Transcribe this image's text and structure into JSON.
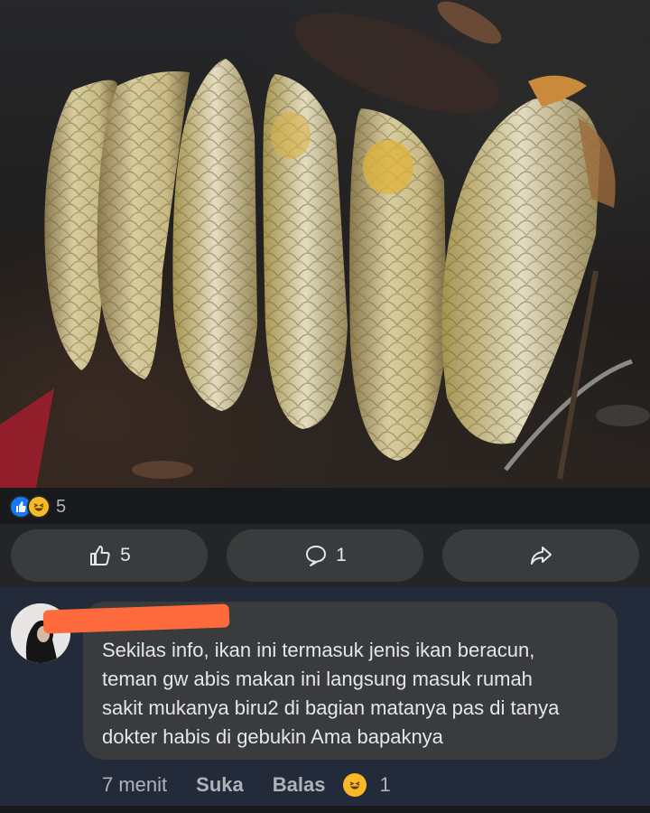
{
  "post": {
    "photo_icon": "photo-of-six-arowana-fish",
    "reactions": {
      "icons": [
        "like-icon",
        "haha-icon"
      ],
      "count": "5"
    }
  },
  "actions": {
    "like_count": "5",
    "comment_count": "1",
    "share_icon": "share-icon"
  },
  "comment": {
    "avatar_icon": "avatar",
    "author_redacted": true,
    "lines": [
      "Sekilas info, ikan ini termasuk jenis ikan beracun,",
      "teman gw abis makan ini langsung masuk rumah",
      "sakit mukanya biru2 di bagian matanya pas di tanya",
      "dokter habis di gebukin Ama bapaknya"
    ],
    "time": "7 menit",
    "like_label": "Suka",
    "reply_label": "Balas",
    "reaction_count": "1"
  },
  "colors": {
    "background": "#18191a",
    "bar": "#242526",
    "pill": "#3a3b3c",
    "like_blue": "#1877f2",
    "haha_yellow": "#f7b928",
    "redaction": "#ff6a3d"
  }
}
